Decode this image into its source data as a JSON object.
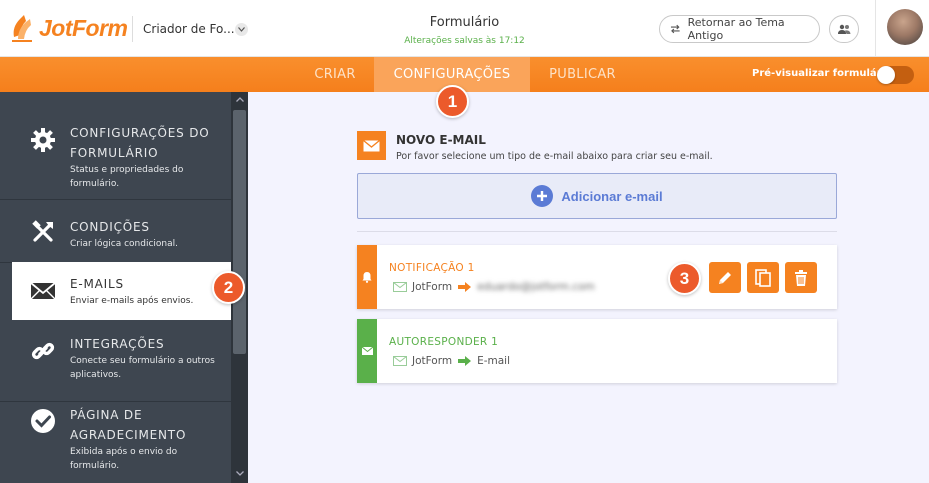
{
  "header": {
    "logo_text": "JotForm",
    "form_name": "Criador de Fo...",
    "form_title": "Formulário",
    "save_status": "Alterações salvas às 17:12",
    "old_theme_button": "Retornar ao Tema Antigo"
  },
  "nav": {
    "tabs": [
      {
        "label": "CRIAR",
        "active": false
      },
      {
        "label": "CONFIGURAÇÕES",
        "active": true
      },
      {
        "label": "PUBLICAR",
        "active": false
      }
    ],
    "preview_label": "Pré-visualizar formulário"
  },
  "sidebar": {
    "items": [
      {
        "title": "CONFIGURAÇÕES DO FORMULÁRIO",
        "desc": "Status e propriedades do formulário.",
        "icon": "gear-icon",
        "active": false
      },
      {
        "title": "CONDIÇÕES",
        "desc": "Criar lógica condicional.",
        "icon": "tools-icon",
        "active": false
      },
      {
        "title": "E-MAILS",
        "desc": "Enviar e-mails após envios.",
        "icon": "envelope-icon",
        "active": true
      },
      {
        "title": "INTEGRAÇÕES",
        "desc": "Conecte seu formulário a outros aplicativos.",
        "icon": "link-icon",
        "active": false
      },
      {
        "title": "PÁGINA DE AGRADECIMENTO",
        "desc": "Exibida após o envio do formulário.",
        "icon": "check-circle-icon",
        "active": false
      }
    ]
  },
  "main": {
    "section_title": "NOVO E-MAIL",
    "section_subtitle": "Por favor selecione um tipo de e-mail abaixo para criar seu e-mail.",
    "add_email_label": "Adicionar e-mail",
    "emails": [
      {
        "title": "NOTIFICAÇÃO 1",
        "from": "JotForm",
        "to": "eduardo@jotform.com",
        "to_blurred": true,
        "color": "#f58220",
        "type_icon": "bell-icon"
      },
      {
        "title": "AUTORESPONDER 1",
        "from": "JotForm",
        "to": "E-mail",
        "to_blurred": false,
        "color": "#5ab04a",
        "type_icon": "envelope-icon"
      }
    ]
  },
  "callouts": [
    "1",
    "2",
    "3"
  ],
  "colors": {
    "brand_orange": "#f58220",
    "sidebar_bg": "#3e4650",
    "accent_blue": "#5b7bd5",
    "success_green": "#5ab04a",
    "callout_red": "#ec5a2b"
  }
}
